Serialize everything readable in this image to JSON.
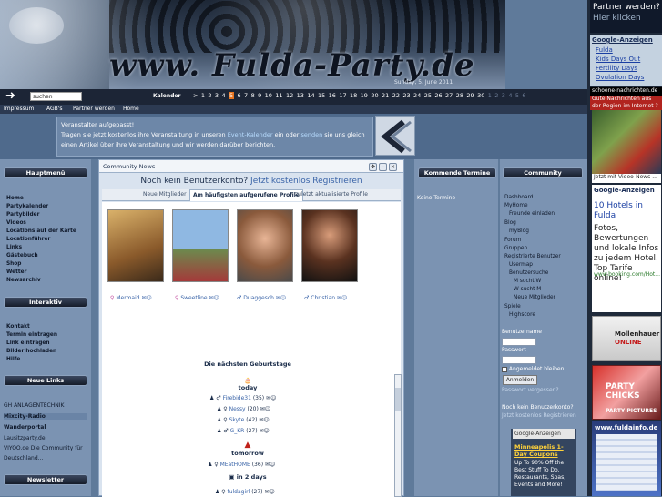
{
  "header": {
    "title": "www. Fulda-Party.de",
    "date": "Sunday, 5. June 2011"
  },
  "nav": {
    "search_value": "suchen",
    "calendar_label": "Kalender",
    "days": [
      ">",
      "1",
      "2",
      "3",
      "4",
      "5",
      "6",
      "7",
      "8",
      "9",
      "10",
      "11",
      "12",
      "13",
      "14",
      "15",
      "16",
      "17",
      "18",
      "19",
      "20",
      "21",
      "22",
      "23",
      "24",
      "25",
      "26",
      "27",
      "28",
      "29",
      "30",
      "1",
      "2",
      "3",
      "4",
      "5",
      "6"
    ],
    "current_day": "5",
    "menu": [
      "Impressum",
      "AGB's",
      "Partner werden",
      "Home"
    ]
  },
  "info": {
    "line1": "Veranstalter aufgepasst!",
    "line2a": "Tragen sie jetzt kostenlos ihre Veranstaltung in unseren ",
    "line2_link1": "Event-Kalender",
    "line2b": " ein oder ",
    "line2_link2": "senden",
    "line2c": " sie uns gleich",
    "line3": "einen Artikel über ihre Veranstaltung und wir werden darüber berichten."
  },
  "left": {
    "hauptmenu_title": "Hauptmenü",
    "hauptmenu": [
      "Home",
      "Partykalender",
      "Partybilder",
      "Videos",
      "Locations auf der Karte",
      "Locationführer",
      "Links",
      "Gästebuch",
      "Shop",
      "Wetter",
      "Newsarchiv"
    ],
    "interaktiv_title": "Interaktiv",
    "interaktiv": [
      "Kontakt",
      "Termin eintragen",
      "Link eintragen",
      "Bilder hochladen",
      "Hilfe"
    ],
    "links_title": "Neue Links",
    "links": [
      "GH ANLAGENTECHNIK",
      "Mixcity-Radio",
      "Wanderportal",
      "Lausitzparty.de",
      "VIYOO.de Die Community für",
      "Deutschland..."
    ],
    "newsletter_title": "Newsletter"
  },
  "community_news": {
    "title": "Community News",
    "promo_text": "Noch kein Benutzerkonto? ",
    "promo_link": "Jetzt kostenlos Registrieren",
    "tabs": [
      "Neue Mitglieder",
      "Am häufigsten aufgerufene Profile",
      "zuletzt aktualisierte Profile"
    ],
    "profiles": [
      "Mermaid",
      "Sweetline",
      "Duaggesch",
      "Christian"
    ],
    "birthday_title": "Die nächsten Geburtstage",
    "today_label": "today",
    "today": [
      {
        "name": "Firebide31",
        "age": "(35)"
      },
      {
        "name": "Nessy",
        "age": "(20)"
      },
      {
        "name": "Skyte",
        "age": "(42)"
      },
      {
        "name": "G_KR",
        "age": "(27)"
      }
    ],
    "tomorrow_label": "tomorrow",
    "tomorrow": [
      {
        "name": "MEatHOME",
        "age": "(36)"
      }
    ],
    "in2_label": "in 2 days",
    "in2": [
      {
        "name": "fuldagirl",
        "age": "(27)"
      }
    ]
  },
  "events": {
    "title": "Kommende Termine",
    "empty": "Keine Termine"
  },
  "community": {
    "title": "Community",
    "items": [
      "Dashboard",
      "MyHome",
      "Freunde einladen",
      "Blog",
      "myBlog",
      "Forum",
      "Gruppen",
      "Registrierte Benutzer",
      "Usermap",
      "Benutzersuche",
      "M sucht W",
      "W sucht M",
      "Neue Mitglieder",
      "Spiele",
      "Highscore"
    ],
    "username_label": "Benutzername",
    "password_label": "Passwort",
    "remember_label": "Angemeldet bleiben",
    "login_button": "Anmelden",
    "forgot": "Passwort vergessen?",
    "no_account": "Noch kein Benutzerkonto?",
    "register": "Jetzt kostenlos Registrieren",
    "google_label": "Google-Anzeigen",
    "ad_title": "Minneapolis 1-Day Coupons",
    "ad_body": "Up To 90% Off the Best Stuff To Do. Restaurants, Spas, Events and More!"
  },
  "right": {
    "partner_title": "Partner werden?",
    "partner_link": "Hier klicken",
    "google_title": "Google-Anzeigen",
    "ads": [
      "Fulda",
      "Kids Days Out",
      "Fertility Days",
      "Ovulation Days"
    ],
    "news_head": "schoene-nachrichten.de",
    "news_sub": "Gute Nachrichten aus der Region im Internet ?",
    "news_caption": "Jetzt mit Video-News ...",
    "hotel_google": "Google-Anzeigen",
    "hotel_title": "10 Hotels in Fulda",
    "hotel_body": "Fotos, Bewertungen und lokale Infos zu jedem Hotel. Top Tarife online!",
    "hotel_url": "www.booking.com/Hot...",
    "moll_line1": "Mollenhauer",
    "moll_line2": "ONLINE",
    "party_line": "PARTY CHICKS",
    "party_sub": "PARTY PICTURES",
    "fuldainfo": "www.fuldainfo.de"
  }
}
